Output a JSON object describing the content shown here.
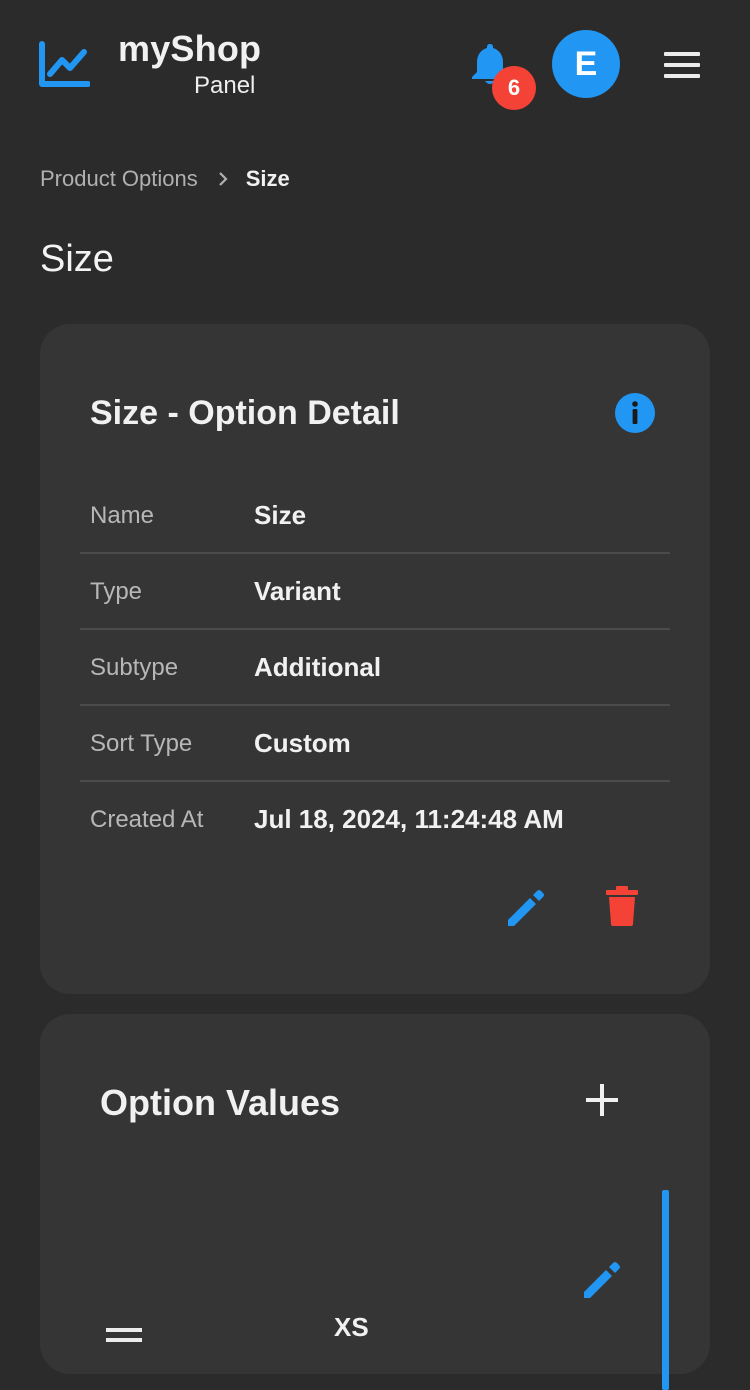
{
  "header": {
    "brand_title": "myShop",
    "brand_subtitle": "Panel",
    "notification_count": "6",
    "avatar_initial": "E"
  },
  "breadcrumb": {
    "parent": "Product Options",
    "current": "Size"
  },
  "page_title": "Size",
  "detail_card": {
    "title": "Size - Option Detail",
    "rows": [
      {
        "label": "Name",
        "value": "Size"
      },
      {
        "label": "Type",
        "value": "Variant"
      },
      {
        "label": "Subtype",
        "value": "Additional"
      },
      {
        "label": "Sort Type",
        "value": "Custom"
      },
      {
        "label": "Created At",
        "value": "Jul 18, 2024, 11:24:48 AM"
      }
    ]
  },
  "values_card": {
    "title": "Option Values",
    "items": [
      {
        "name": "XS"
      }
    ]
  },
  "colors": {
    "accent": "#2196f3",
    "danger": "#f44336",
    "background": "#2b2b2b",
    "card": "#353535"
  },
  "icons": [
    "chart-line-icon",
    "bell-icon",
    "menu-icon",
    "chevron-right-icon",
    "info-icon",
    "pencil-icon",
    "trash-icon",
    "plus-icon",
    "drag-handle-icon"
  ]
}
